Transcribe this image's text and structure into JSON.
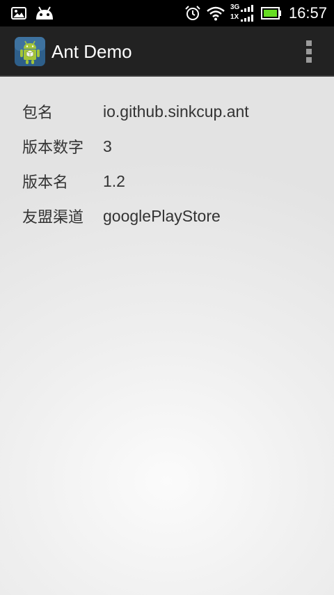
{
  "status_bar": {
    "time": "16:57",
    "network_type": "3G",
    "network_type_2": "1X",
    "battery_color": "#66dd22",
    "icons": [
      "image-notification-icon",
      "android-notification-icon",
      "alarm-icon",
      "wifi-icon",
      "signal-icon",
      "battery-icon"
    ]
  },
  "action_bar": {
    "title": "Ant Demo",
    "app_icon": "android-app-icon",
    "overflow_icon": "overflow-menu-icon"
  },
  "info": {
    "rows": [
      {
        "label": "包名",
        "value": "io.github.sinkcup.ant"
      },
      {
        "label": "版本数字",
        "value": "3"
      },
      {
        "label": "版本名",
        "value": "1.2"
      },
      {
        "label": "友盟渠道",
        "value": "googlePlayStore"
      }
    ]
  }
}
